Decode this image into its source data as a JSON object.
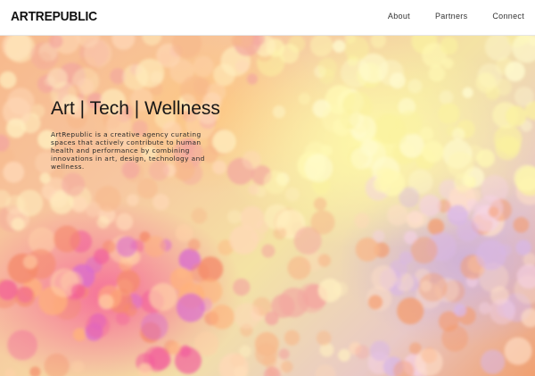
{
  "header": {
    "logo": "ARTREPUBLIC",
    "nav": [
      {
        "label": "About"
      },
      {
        "label": "Partners"
      },
      {
        "label": "Connect"
      }
    ]
  },
  "hero": {
    "headline": "Art | Tech | Wellness",
    "description": "ArtRepublic is a creative agency curating spaces that actively contribute to human health and performance by combining innovations in art, design, technology and wellness.",
    "background_palette": [
      "#f59a6a",
      "#f3cf8c",
      "#fff6a8",
      "#f25d9c",
      "#c8a9de",
      "#ffd9b8"
    ]
  }
}
